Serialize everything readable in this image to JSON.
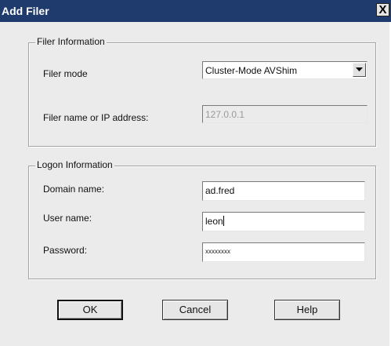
{
  "window": {
    "title": "Add Filer",
    "close_glyph": "X"
  },
  "filer_info": {
    "group_title": "Filer Information",
    "mode_label": "Filer mode",
    "mode_value": "Cluster-Mode AVShim",
    "address_label": "Filer name or IP address:",
    "address_value": "127.0.0.1"
  },
  "logon_info": {
    "group_title": "Logon Information",
    "domain_label": "Domain name:",
    "domain_value": "ad.fred",
    "user_label": "User name:",
    "user_value": "leon",
    "password_label": "Password:",
    "password_value": "xxxxxxxx"
  },
  "buttons": {
    "ok_label": "OK",
    "cancel_label": "Cancel",
    "help_label": "Help"
  }
}
